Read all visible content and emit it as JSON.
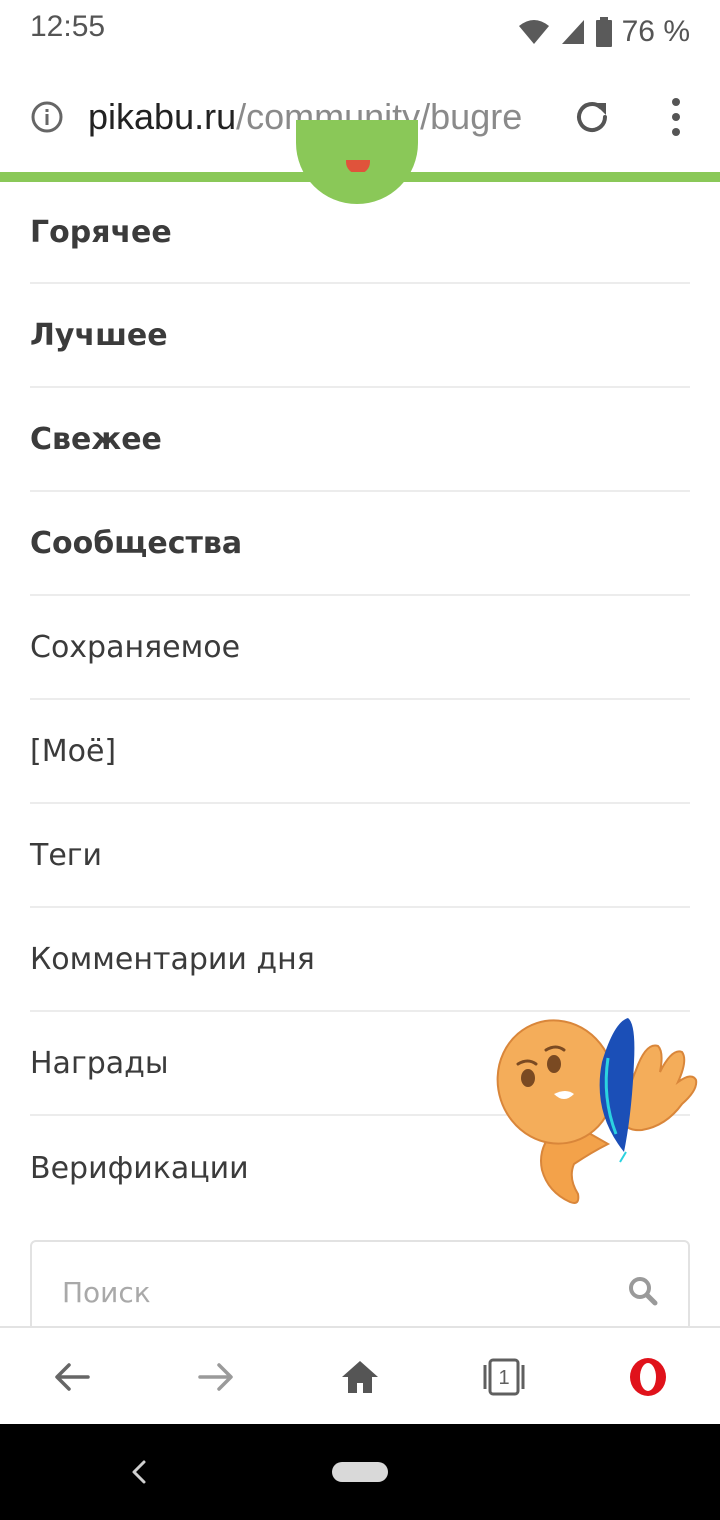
{
  "status_bar": {
    "time": "12:55",
    "battery_percent": "76 %",
    "icons": [
      "wifi-icon",
      "cell-signal-icon",
      "battery-icon"
    ]
  },
  "address_bar": {
    "url_host": "pikabu.ru",
    "url_path": "/community/bugre",
    "icons": [
      "info-icon",
      "reload-icon",
      "overflow-menu-icon"
    ]
  },
  "menu": {
    "items": [
      {
        "label": "Горячее"
      },
      {
        "label": "Лучшее"
      },
      {
        "label": "Свежее"
      },
      {
        "label": "Сообщества"
      },
      {
        "label": "Сохраняемое"
      },
      {
        "label": "[Моё]"
      },
      {
        "label": "Теги"
      },
      {
        "label": "Комментарии дня"
      },
      {
        "label": "Награды"
      },
      {
        "label": "Верификации"
      }
    ]
  },
  "search": {
    "placeholder": "Поиск",
    "value": ""
  },
  "bottom_toolbar": {
    "tabs_count": "1",
    "icons": [
      "back-arrow-icon",
      "forward-arrow-icon",
      "home-icon",
      "tabs-icon",
      "opera-logo-icon"
    ]
  },
  "colors": {
    "accent_green": "#8ac858",
    "opera_red": "#e0121b",
    "text_dark": "#3b3b3b",
    "url_path_gray": "#8a8a8a"
  }
}
